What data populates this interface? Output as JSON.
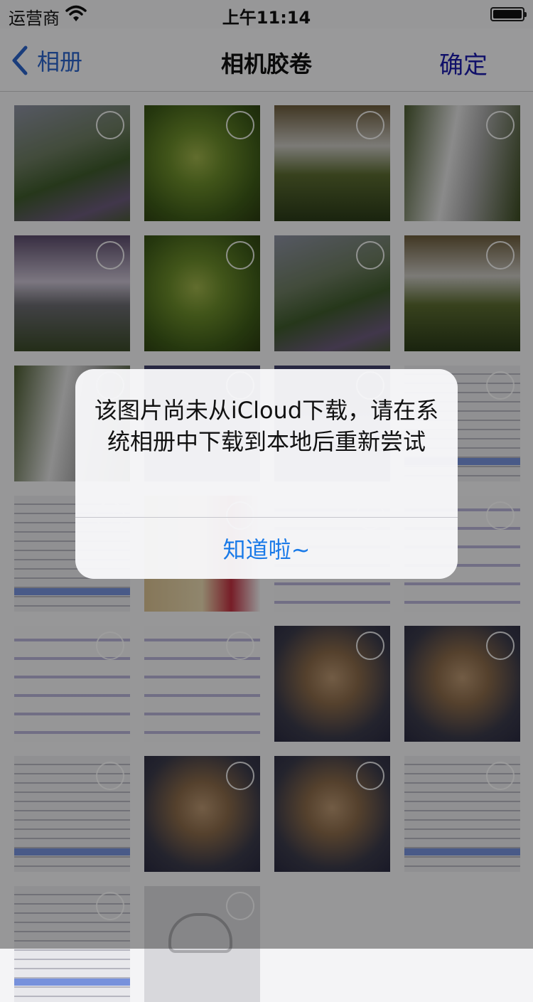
{
  "status_bar": {
    "carrier": "运营商",
    "time": "上午11:14",
    "battery_level": 1.0
  },
  "nav": {
    "back_label": "相册",
    "title": "相机胶卷",
    "confirm_label": "确定"
  },
  "photos": [
    {
      "type": "ph-grass"
    },
    {
      "type": "ph-leaf"
    },
    {
      "type": "ph-fall1"
    },
    {
      "type": "ph-fall2"
    },
    {
      "type": "ph-fall3"
    },
    {
      "type": "ph-leaf"
    },
    {
      "type": "ph-grass"
    },
    {
      "type": "ph-fall1"
    },
    {
      "type": "ph-fall2"
    },
    {
      "type": "ph-dark"
    },
    {
      "type": "ph-dark"
    },
    {
      "type": "ph-screen"
    },
    {
      "type": "ph-screen"
    },
    {
      "type": "ph-food"
    },
    {
      "type": "ph-code"
    },
    {
      "type": "ph-code"
    },
    {
      "type": "ph-code"
    },
    {
      "type": "ph-code"
    },
    {
      "type": "ph-dog"
    },
    {
      "type": "ph-dog"
    },
    {
      "type": "ph-screen"
    },
    {
      "type": "ph-dog"
    },
    {
      "type": "ph-dog"
    },
    {
      "type": "ph-screen"
    },
    {
      "type": "ph-screen"
    },
    {
      "type": "ph-cloud"
    }
  ],
  "alert": {
    "message": "该图片尚未从iCloud下载，请在系统相册中下载到本地后重新尝试",
    "button_label": "知道啦~"
  },
  "colors": {
    "back_blue": "#2a63c8",
    "confirm_blue": "#1a1aaa",
    "alert_button_blue": "#1a7ae8"
  }
}
